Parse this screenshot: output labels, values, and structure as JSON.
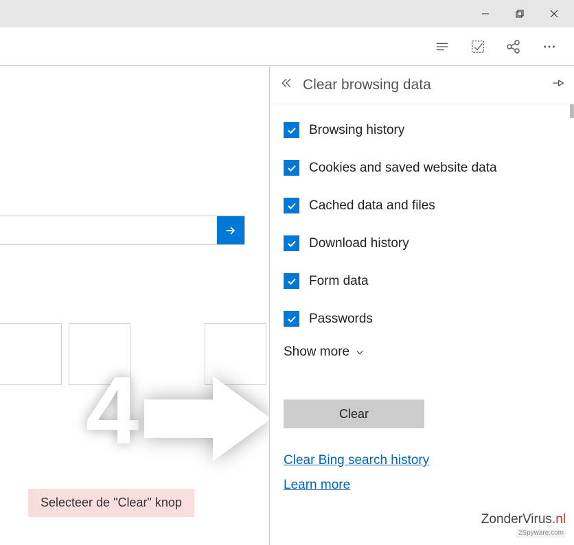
{
  "titlebar": {
    "minimize": "minimize-icon",
    "maximize": "maximize-icon",
    "close": "close-icon"
  },
  "toolbar": {
    "reading": "reading-list-icon",
    "notes": "web-note-icon",
    "share": "share-icon",
    "more": "more-icon"
  },
  "search": {
    "value": "",
    "go": "arrow-right-icon"
  },
  "step": {
    "number": "4",
    "caption": "Selecteer de \"Clear\" knop"
  },
  "panel": {
    "title": "Clear browsing data",
    "items": [
      {
        "label": "Browsing history",
        "checked": true
      },
      {
        "label": "Cookies and saved website data",
        "checked": true
      },
      {
        "label": "Cached data and files",
        "checked": true
      },
      {
        "label": "Download history",
        "checked": true
      },
      {
        "label": "Form data",
        "checked": true
      },
      {
        "label": "Passwords",
        "checked": true
      }
    ],
    "show_more": "Show more",
    "clear_button": "Clear",
    "link_bing": "Clear Bing search history",
    "link_learn": "Learn more"
  },
  "watermark": {
    "brand_main": "ZonderVirus",
    "brand_tld": ".nl",
    "subtext": "2Spyware.com"
  }
}
